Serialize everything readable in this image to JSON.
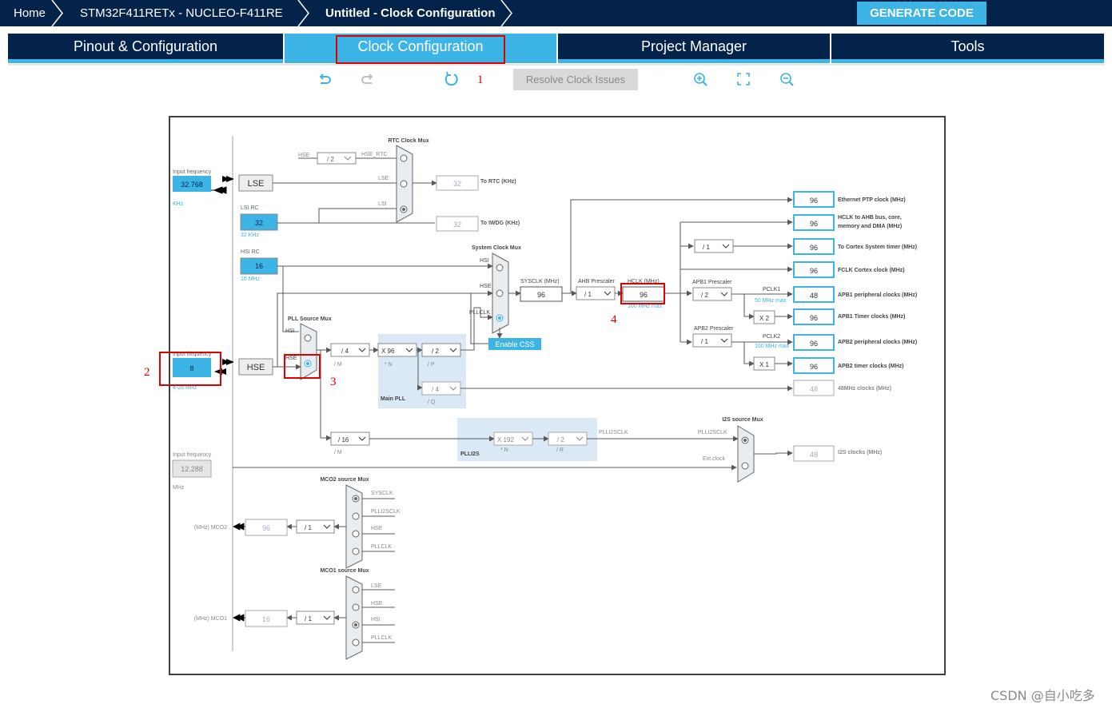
{
  "breadcrumb": [
    "Home",
    "STM32F411RETx  -  NUCLEO-F411RE",
    "Untitled - Clock Configuration"
  ],
  "generate_code": "GENERATE CODE",
  "tabs": [
    "Pinout & Configuration",
    "Clock Configuration",
    "Project Manager",
    "Tools"
  ],
  "toolbar": {
    "resolve": "Resolve Clock Issues",
    "icons": [
      "undo-icon",
      "redo-icon",
      "refresh-icon",
      "zoom-in-icon",
      "fit-to-window-icon",
      "zoom-out-icon"
    ]
  },
  "annotations": [
    "1",
    "2",
    "3",
    "4"
  ],
  "inputs": {
    "lse": {
      "label": "Input frequency",
      "value": "32.768",
      "unit": "KHz",
      "block": "LSE"
    },
    "lsi": {
      "label": "LSI RC",
      "value": "32",
      "unit": "32 KHz"
    },
    "hsi": {
      "label": "HSI RC",
      "value": "16",
      "unit": "16 MHz"
    },
    "hse": {
      "label": "Input frequency",
      "value": "8",
      "unit": "4-26 MHz",
      "block": "HSE"
    },
    "ext": {
      "label": "Input frequency",
      "value": "12.288",
      "unit": "MHz"
    }
  },
  "rtc": {
    "mux_title": "RTC Clock Mux",
    "hse_label": "HSE",
    "div": "/ 2",
    "hse_rtc_label": "HSE_RTC",
    "lse_label": "LSE",
    "lsi_label": "LSI",
    "rtc_value": "32",
    "rtc_label": "To RTC (KHz)",
    "iwdg_value": "32",
    "iwdg_label": "To IWDG (KHz)"
  },
  "pll": {
    "source_mux": "PLL Source Mux",
    "hsi_label": "HSI",
    "hse_label": "HSE",
    "m": "/ 4",
    "m_label": "/ M",
    "n": "X 96",
    "n_label": "* N",
    "p": "/ 2",
    "p_label": "/ P",
    "q": "/ 4",
    "q_label": "/ Q",
    "main_label": "Main PLL"
  },
  "sysmux": {
    "title": "System Clock Mux",
    "hsi": "HSI",
    "hse": "HSE",
    "pllclk": "PLLCLK",
    "css": "Enable CSS"
  },
  "sysclk": {
    "label": "SYSCLK (MHz)",
    "value": "96"
  },
  "ahb": {
    "label": "AHB Prescaler",
    "value": "/ 1"
  },
  "hclk": {
    "label": "HCLK (MHz)",
    "value": "96",
    "max": "100 MHz max"
  },
  "apb1": {
    "label": "APB1 Prescaler",
    "value": "/ 2",
    "pclk": "PCLK1",
    "max": "50 MHz max",
    "timer_mul": "X 2"
  },
  "apb2": {
    "label": "APB2 Prescaler",
    "value": "/ 1",
    "pclk": "PCLK2",
    "max": "100 MHz max",
    "timer_mul": "X 1"
  },
  "cortex_div": "/ 1",
  "outputs": [
    {
      "value": "96",
      "label": "Ethernet PTP clock (MHz)"
    },
    {
      "value": "96",
      "label": "HCLK to AHB bus, core,",
      "label2": "memory and DMA (MHz)"
    },
    {
      "value": "96",
      "label": "To Cortex System timer (MHz)"
    },
    {
      "value": "96",
      "label": "FCLK Cortex clock (MHz)"
    },
    {
      "value": "48",
      "label": "APB1 peripheral clocks (MHz)"
    },
    {
      "value": "96",
      "label": "APB1 Timer clocks (MHz)"
    },
    {
      "value": "96",
      "label": "APB2 peripheral clocks (MHz)"
    },
    {
      "value": "96",
      "label": "APB2 timer clocks (MHz)"
    },
    {
      "value": "48",
      "label": "48MHz clocks (MHz)"
    }
  ],
  "plli2s": {
    "m": "/ 16",
    "m_label": "/ M",
    "n": "X 192",
    "n_label": "* N",
    "r": "/ 2",
    "r_label": "/ R",
    "label": "PLLI2S",
    "clk_label": "PLLI2SCLK",
    "mux_title": "I2S source Mux",
    "mux_in1": "PLLI2SCLK",
    "mux_in2": "Ext.clock",
    "out_value": "48",
    "out_label": "I2S clocks (MHz)"
  },
  "mco2": {
    "title": "MCO2 source Mux",
    "inputs": [
      "SYSCLK",
      "PLLI2SCLK",
      "HSE",
      "PLLCLK"
    ],
    "div": "/ 1",
    "value": "96",
    "label": "(MHz) MCO2"
  },
  "mco1": {
    "title": "MCO1 source Mux",
    "inputs": [
      "LSE",
      "HSE",
      "HSI",
      "PLLCLK"
    ],
    "div": "/ 1",
    "value": "16",
    "label": "(MHz) MCO1"
  },
  "watermark": "CSDN @自小吃多",
  "colors": {
    "navy": "#03234b",
    "accent": "#3cb4e6",
    "red": "#e00000",
    "line": "#595959",
    "blocklight": "#dae9f5"
  }
}
